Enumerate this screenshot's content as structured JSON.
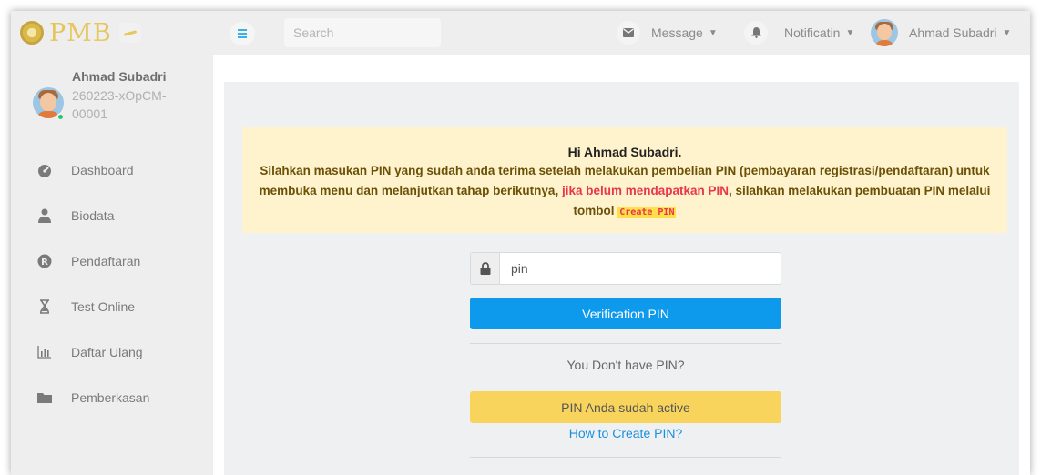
{
  "brand": {
    "logo_text": "PMB"
  },
  "colors": {
    "accent_blue": "#0d99ec",
    "warning_yellow": "#f8d45c",
    "alert_bg": "#fff3cd",
    "alert_red": "#e8364c",
    "online": "#28c76f"
  },
  "sidebar": {
    "user": {
      "name": "Ahmad Subadri",
      "id": "260223-xOpCM-00001"
    },
    "items": [
      {
        "label": "Dashboard",
        "icon": "dashboard-icon"
      },
      {
        "label": "Biodata",
        "icon": "user-icon"
      },
      {
        "label": "Pendaftaran",
        "icon": "registered-icon"
      },
      {
        "label": "Test Online",
        "icon": "hourglass-icon"
      },
      {
        "label": "Daftar Ulang",
        "icon": "bar-chart-icon"
      },
      {
        "label": "Pemberkasan",
        "icon": "folder-icon"
      }
    ]
  },
  "topbar": {
    "search_placeholder": "Search",
    "message_label": "Message",
    "notification_label": "Notificatin",
    "user_name": "Ahmad Subadri"
  },
  "alert": {
    "greeting": "Hi Ahmad Subadri.",
    "text_part1": "Silahkan masukan PIN yang sudah anda terima setelah melakukan pembelian PIN (pembayaran registrasi/pendaftaran) untuk membuka menu dan melanjutkan tahap berikutnya,",
    "text_red": "jika belum mendapatkan PIN",
    "text_part2": ", silahkan melakukan pembuatan PIN melalui tombol",
    "create_pin_tag": "Create PIN"
  },
  "pin_form": {
    "placeholder": "pin",
    "verify_button": "Verification PIN",
    "no_pin_text": "You Don't have PIN?",
    "active_button": "PIN Anda sudah active",
    "howto_link": "How to Create PIN?"
  }
}
